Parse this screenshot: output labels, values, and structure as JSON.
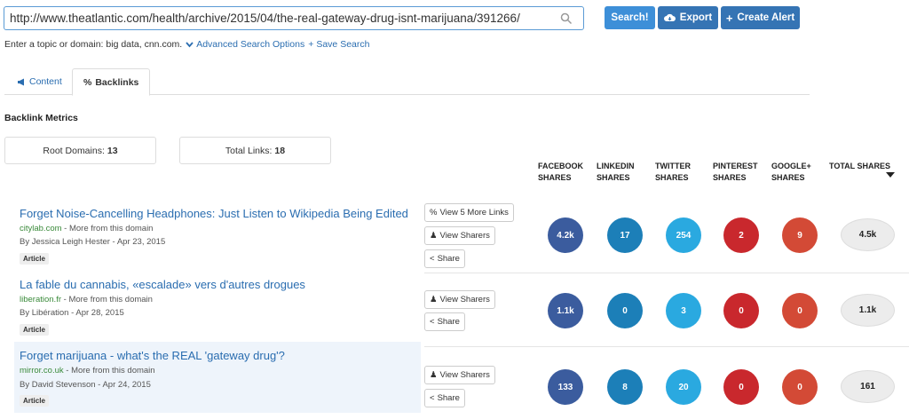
{
  "search": {
    "value": "http://www.theatlantic.com/health/archive/2015/04/the-real-gateway-drug-isnt-marijuana/391266/",
    "search_label": "Search!",
    "export_label": "Export",
    "alert_label": "Create Alert"
  },
  "hint": {
    "text": "Enter a topic or domain: big data, cnn.com.",
    "advanced": "Advanced Search Options",
    "save": "Save Search"
  },
  "tabs": [
    {
      "label": "Content",
      "icon": "megaphone-icon"
    },
    {
      "label": "Backlinks",
      "icon": "link-icon",
      "active": true
    }
  ],
  "metrics": {
    "title": "Backlink Metrics",
    "root_label": "Root Domains:",
    "root_value": "13",
    "total_label": "Total Links:",
    "total_value": "18"
  },
  "columns": [
    {
      "label": "FACEBOOK\nSHARES"
    },
    {
      "label": "LINKEDIN\nSHARES"
    },
    {
      "label": "TWITTER\nSHARES"
    },
    {
      "label": "PINTEREST\nSHARES"
    },
    {
      "label": "GOOGLE+\nSHARES"
    },
    {
      "label": "TOTAL SHARES"
    }
  ],
  "buttons": {
    "view_more": "View 5 More Links",
    "view_sharers": "View Sharers",
    "share": "Share"
  },
  "rows": [
    {
      "title": "Forget Noise-Cancelling Headphones: Just Listen to Wikipedia Being Edited",
      "domain": "citylab.com",
      "more": "- More from this domain",
      "byline": "By Jessica Leigh Hester - Apr 23, 2015",
      "badge": "Article",
      "facebook": "4.2k",
      "linkedin": "17",
      "twitter": "254",
      "pinterest": "2",
      "google": "9",
      "total": "4.5k"
    },
    {
      "title": "La fable du cannabis, «escalade» vers d'autres drogues",
      "domain": "liberation.fr",
      "more": "- More from this domain",
      "byline": "By Libération - Apr 28, 2015",
      "badge": "Article",
      "facebook": "1.1k",
      "linkedin": "0",
      "twitter": "3",
      "pinterest": "0",
      "google": "0",
      "total": "1.1k"
    },
    {
      "title": "Forget marijuana - what's the REAL 'gateway drug'?",
      "domain": "mirror.co.uk",
      "more": "- More from this domain",
      "byline": "By David Stevenson - Apr 24, 2015",
      "badge": "Article",
      "facebook": "133",
      "linkedin": "8",
      "twitter": "20",
      "pinterest": "0",
      "google": "0",
      "total": "161"
    }
  ],
  "colors": {
    "facebook": "#3b5c9e",
    "linkedin": "#1c7fb8",
    "twitter": "#2aa9e0",
    "pinterest": "#c9282d",
    "google": "#d34a36"
  }
}
